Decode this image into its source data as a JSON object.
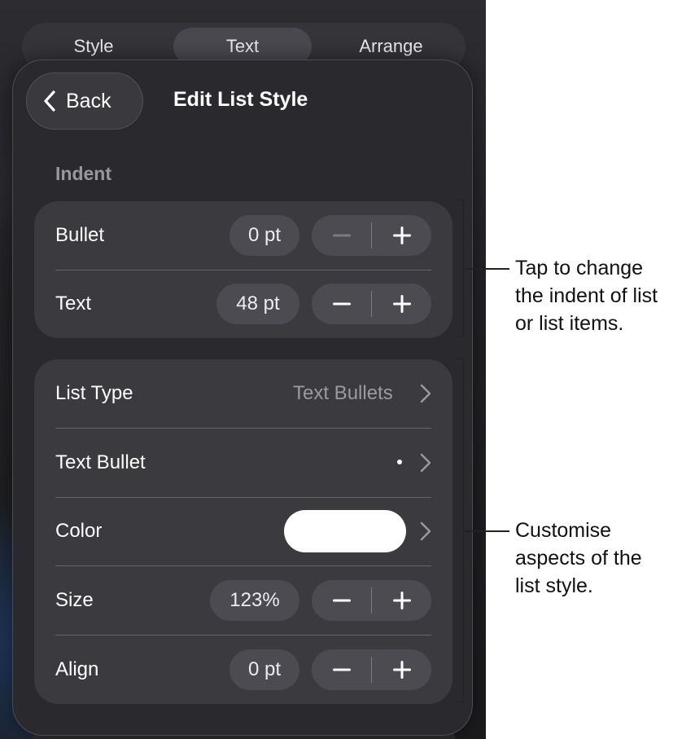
{
  "tabs": [
    {
      "label": "Style",
      "active": false
    },
    {
      "label": "Text",
      "active": true
    },
    {
      "label": "Arrange",
      "active": false
    }
  ],
  "header": {
    "back_label": "Back",
    "title": "Edit List Style"
  },
  "indent": {
    "section_label": "Indent",
    "bullet": {
      "label": "Bullet",
      "value": "0 pt"
    },
    "text": {
      "label": "Text",
      "value": "48 pt"
    }
  },
  "list": {
    "list_type": {
      "label": "List Type",
      "value": "Text Bullets"
    },
    "text_bullet": {
      "label": "Text Bullet",
      "value": "•"
    },
    "color": {
      "label": "Color",
      "swatch": "#ffffff"
    },
    "size": {
      "label": "Size",
      "value": "123%"
    },
    "align": {
      "label": "Align",
      "value": "0 pt"
    }
  },
  "callouts": {
    "indent_note": [
      "Tap to change",
      "the indent of list",
      "or list items."
    ],
    "style_note": [
      "Customise",
      "aspects of the",
      "list style."
    ]
  },
  "colors": {
    "sheet_bg": "#2a2a2e",
    "card_bg": "#3a3a3f",
    "pill_bg": "#4b4b51",
    "secondary_text": "#9a9aa0",
    "disabled_icon": "#7a7a80"
  }
}
